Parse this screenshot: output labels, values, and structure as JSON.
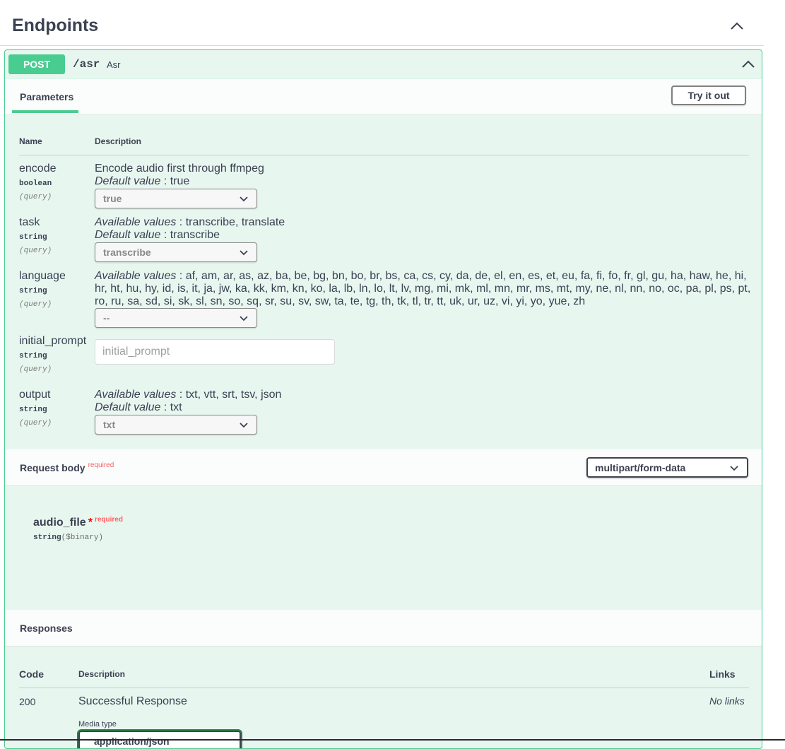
{
  "section": {
    "title": "Endpoints"
  },
  "operation": {
    "method": "POST",
    "path": "/asr",
    "summary": "Asr",
    "tab_label": "Parameters",
    "try_label": "Try it out"
  },
  "params_table": {
    "headers": {
      "name": "Name",
      "description": "Description"
    },
    "encode": {
      "name": "encode",
      "type": "boolean",
      "in": "(query)",
      "desc": "Encode audio first through ffmpeg",
      "default_label": "Default value",
      "default_value": ": true",
      "selected": "true"
    },
    "task": {
      "name": "task",
      "type": "string",
      "in": "(query)",
      "avail_label": "Available values",
      "avail_values": ": transcribe, translate",
      "default_label": "Default value",
      "default_value": ": transcribe",
      "selected": "transcribe"
    },
    "language": {
      "name": "language",
      "type": "string",
      "in": "(query)",
      "avail_label": "Available values",
      "avail_values": ": af, am, ar, as, az, ba, be, bg, bn, bo, br, bs, ca, cs, cy, da, de, el, en, es, et, eu, fa, fi, fo, fr, gl, gu, ha, haw, he, hi, hr, ht, hu, hy, id, is, it, ja, jw, ka, kk, km, kn, ko, la, lb, ln, lo, lt, lv, mg, mi, mk, ml, mn, mr, ms, mt, my, ne, nl, nn, no, oc, pa, pl, ps, pt, ro, ru, sa, sd, si, sk, sl, sn, so, sq, sr, su, sv, sw, ta, te, tg, th, tk, tl, tr, tt, uk, ur, uz, vi, yi, yo, yue, zh",
      "selected": "--"
    },
    "initial_prompt": {
      "name": "initial_prompt",
      "type": "string",
      "in": "(query)",
      "placeholder": "initial_prompt"
    },
    "output": {
      "name": "output",
      "type": "string",
      "in": "(query)",
      "avail_label": "Available values",
      "avail_values": ": txt, vtt, srt, tsv, json",
      "default_label": "Default value",
      "default_value": ": txt",
      "selected": "txt"
    }
  },
  "request_body": {
    "title": "Request body",
    "required": "required",
    "content_type": "multipart/form-data",
    "field": {
      "name": "audio_file",
      "star": "*",
      "required": "required",
      "type": "string",
      "format": "($binary)"
    }
  },
  "responses": {
    "title": "Responses",
    "headers": {
      "code": "Code",
      "description": "Description",
      "links": "Links"
    },
    "rows": [
      {
        "code": "200",
        "description": "Successful Response",
        "links": "No links",
        "media_type_label": "Media type",
        "media_type": "application/json"
      }
    ]
  },
  "colors": {
    "post": "#49cc90",
    "post_bg": "#e8f6f0",
    "required": "#ff6060"
  },
  "icons": {
    "collapse": "chevron-up-icon",
    "dropdown": "chevron-down-icon"
  }
}
